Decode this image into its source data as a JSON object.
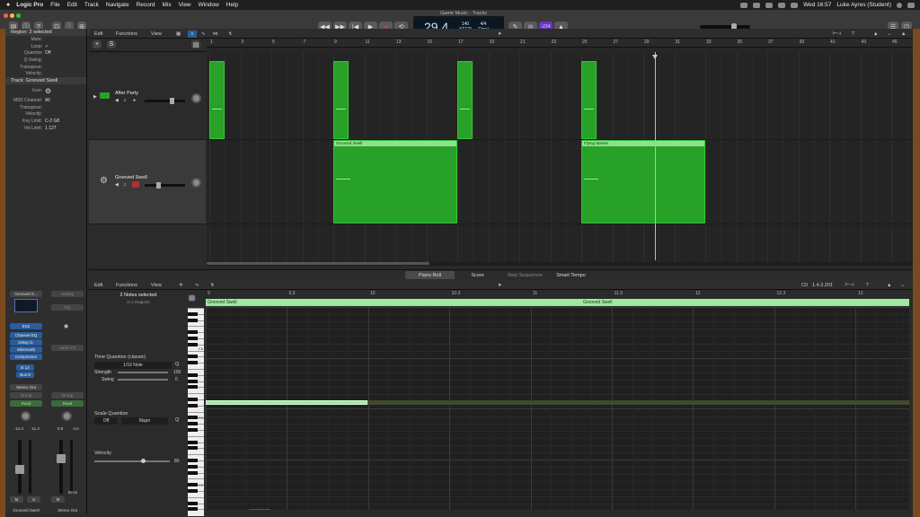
{
  "menubar": {
    "app": "Logic Pro",
    "items": [
      "File",
      "Edit",
      "Track",
      "Navigate",
      "Record",
      "Mix",
      "View",
      "Window",
      "Help"
    ],
    "clock": "Wed 16:57",
    "user": "Luke Ayres (Student)"
  },
  "window": {
    "title": "Game Music - Tracks"
  },
  "lcd": {
    "position": "29.4",
    "tempo": "140",
    "tempo_label": "KEEP",
    "sig": "4/4",
    "key": "Cmaj",
    "count_in": "‹234"
  },
  "inspector": {
    "region_header": "Region: 2 selected",
    "region_rows": [
      {
        "k": "Mute:",
        "v": ""
      },
      {
        "k": "Loop:",
        "v": "✓"
      },
      {
        "k": "Quantize",
        "v": "Off"
      },
      {
        "k": "Q-Swing:",
        "v": ""
      },
      {
        "k": "Transpose:",
        "v": ""
      },
      {
        "k": "Velocity:",
        "v": ""
      }
    ],
    "track_header": "Track: Grooved Swell",
    "icon_label": "Icon:",
    "track_rows": [
      {
        "k": "MIDI Channel:",
        "v": "All"
      },
      {
        "k": "Transpose:",
        "v": ""
      },
      {
        "k": "Velocity:",
        "v": ""
      },
      {
        "k": "Key Limit:",
        "v": "C-2  G8"
      },
      {
        "k": "Vel Limit:",
        "v": "1  127"
      }
    ]
  },
  "tracks_toolbar": {
    "edit": "Edit",
    "functions": "Functions",
    "view": "View",
    "add": "+",
    "s": "S"
  },
  "ruler_bars": [
    "1",
    "3",
    "5",
    "7",
    "9",
    "11",
    "13",
    "15",
    "17",
    "19",
    "21",
    "23",
    "25",
    "27",
    "29",
    "31",
    "33",
    "35",
    "37",
    "39",
    "41",
    "43",
    "45"
  ],
  "tracks": [
    {
      "name": "After Party",
      "regions": []
    },
    {
      "name": "Grooved Swell",
      "regions": [
        {
          "label": "Grooved Swell"
        },
        {
          "label": "Flying Waves"
        }
      ]
    }
  ],
  "bottom_tabs": [
    "Piano Roll",
    "Score",
    "Step Sequencer",
    "Smart Tempo"
  ],
  "piano_roll": {
    "edit": "Edit",
    "functions": "Functions",
    "view": "View",
    "pitch": "C0",
    "position": "1.4.3.201",
    "notes_selected": "2 Notes selected",
    "in_regions": "in 2 Regions",
    "time_quantize": "Time Quantize (classic)",
    "q_value": "1/16 Note",
    "strength_label": "Strength",
    "strength": "100",
    "swing_label": "Swing",
    "swing": "0",
    "scale_quantize": "Scale Quantize",
    "scale_off": "Off",
    "scale_mode": "Major",
    "velocity_label": "Velocity",
    "velocity": "80",
    "ruler": [
      "9",
      "9.3",
      "10",
      "10.3",
      "11",
      "11.3",
      "12",
      "12.3",
      "13"
    ],
    "region1": "Grooved Swell",
    "region2": "Grooved Swell",
    "key_labels": [
      "C5",
      "C4",
      "C3"
    ]
  },
  "mixer": {
    "strip1": {
      "name": "Grooved S...",
      "plugins": [
        "ES2",
        "Channel EQ",
        "Delay D.",
        "Silververb",
        "Compressor"
      ],
      "sends": [
        "B 12",
        "Bus 8"
      ],
      "output": "Stereo Out",
      "group": "Group",
      "auto": "Read",
      "pan_vals": [
        "-12.4",
        "-11.4"
      ],
      "m": "M",
      "s": "S",
      "footer": "Grooved Swell"
    },
    "strip2": {
      "name": "Setting",
      "eq": "EQ",
      "audio": "Audio FX",
      "output": "",
      "group": "Group",
      "auto": "Read",
      "pan_vals": [
        "0.0",
        "-4.5"
      ],
      "m": "M",
      "bnce": "Bnce",
      "footer": "Stereo Out"
    }
  }
}
